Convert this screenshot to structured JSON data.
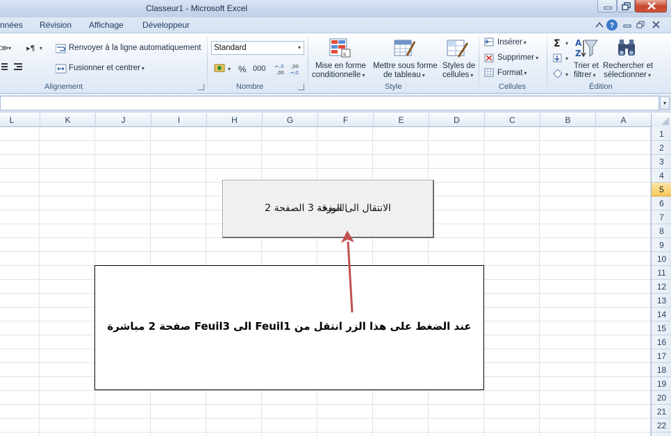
{
  "window": {
    "title": "Classeur1  -  Microsoft Excel"
  },
  "tabs": [
    {
      "label": "nnées"
    },
    {
      "label": "Révision"
    },
    {
      "label": "Affichage"
    },
    {
      "label": "Développeur"
    }
  ],
  "ribbon": {
    "alignment": {
      "wrap_text": "Renvoyer à la ligne automatiquement",
      "merge_center": "Fusionner et centrer",
      "group_label": "Alignement"
    },
    "number": {
      "format_value": "Standard",
      "percent": "%",
      "thousands": "000",
      "group_label": "Nombre"
    },
    "style": {
      "conditional_1": "Mise en forme",
      "conditional_2": "conditionnelle",
      "table_1": "Mettre sous forme",
      "table_2": "de tableau",
      "cell_styles_1": "Styles de",
      "cell_styles_2": "cellules",
      "group_label": "Style"
    },
    "cells": {
      "insert": "Insérer",
      "delete": "Supprimer",
      "format": "Format",
      "group_label": "Cellules"
    },
    "editing": {
      "sort_1": "Trier et",
      "sort_2": "filtrer",
      "find_1": "Rechercher et",
      "find_2": "sélectionner",
      "group_label": "Édition"
    }
  },
  "columns": [
    "L",
    "K",
    "J",
    "I",
    "H",
    "G",
    "F",
    "E",
    "D",
    "C",
    "B",
    "A"
  ],
  "rows": [
    "1",
    "2",
    "3",
    "4",
    "5",
    "6",
    "7",
    "8",
    "9",
    "10",
    "11",
    "12",
    "13",
    "14",
    "15",
    "16",
    "17",
    "18",
    "19",
    "20",
    "21",
    "22"
  ],
  "active_row": "5",
  "sheet_button": {
    "label_a": "الانتقال الى الورقة 3 الصفحة 2",
    "label_b": "الصفحة"
  },
  "note": {
    "text": "عند الضغط على هذا الزر انتقل من Feuil1 الى Feuil3 صفحة 2 مباشرة"
  },
  "colors": {
    "arrow": "#c0504d",
    "active_row_header": "#f9c95b"
  }
}
